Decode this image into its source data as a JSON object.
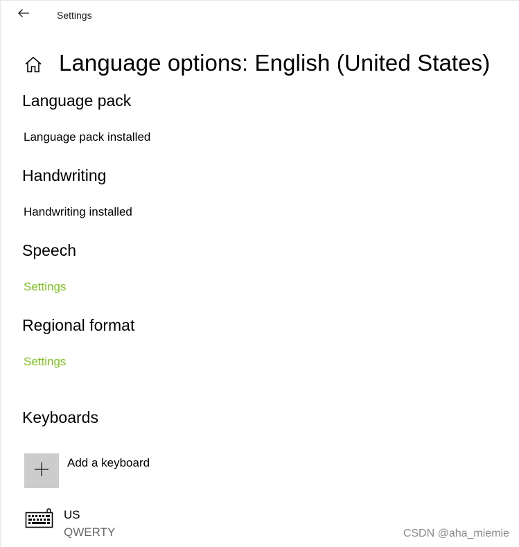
{
  "window": {
    "app_title": "Settings"
  },
  "page": {
    "title": "Language options: English (United States)"
  },
  "sections": {
    "language_pack": {
      "heading": "Language pack",
      "status": "Language pack installed"
    },
    "handwriting": {
      "heading": "Handwriting",
      "status": "Handwriting installed"
    },
    "speech": {
      "heading": "Speech",
      "link": "Settings"
    },
    "regional_format": {
      "heading": "Regional format",
      "link": "Settings"
    },
    "keyboards": {
      "heading": "Keyboards",
      "add_label": "Add a keyboard",
      "items": [
        {
          "name": "US",
          "layout": "QWERTY"
        }
      ]
    }
  },
  "watermark": "CSDN @aha_miemie",
  "colors": {
    "accent": "#7cc21e",
    "add_tile": "#cccccc",
    "secondary_text": "#666666"
  },
  "icons": {
    "back": "back-arrow-icon",
    "home": "home-icon",
    "add": "plus-icon",
    "keyboard": "keyboard-icon"
  }
}
